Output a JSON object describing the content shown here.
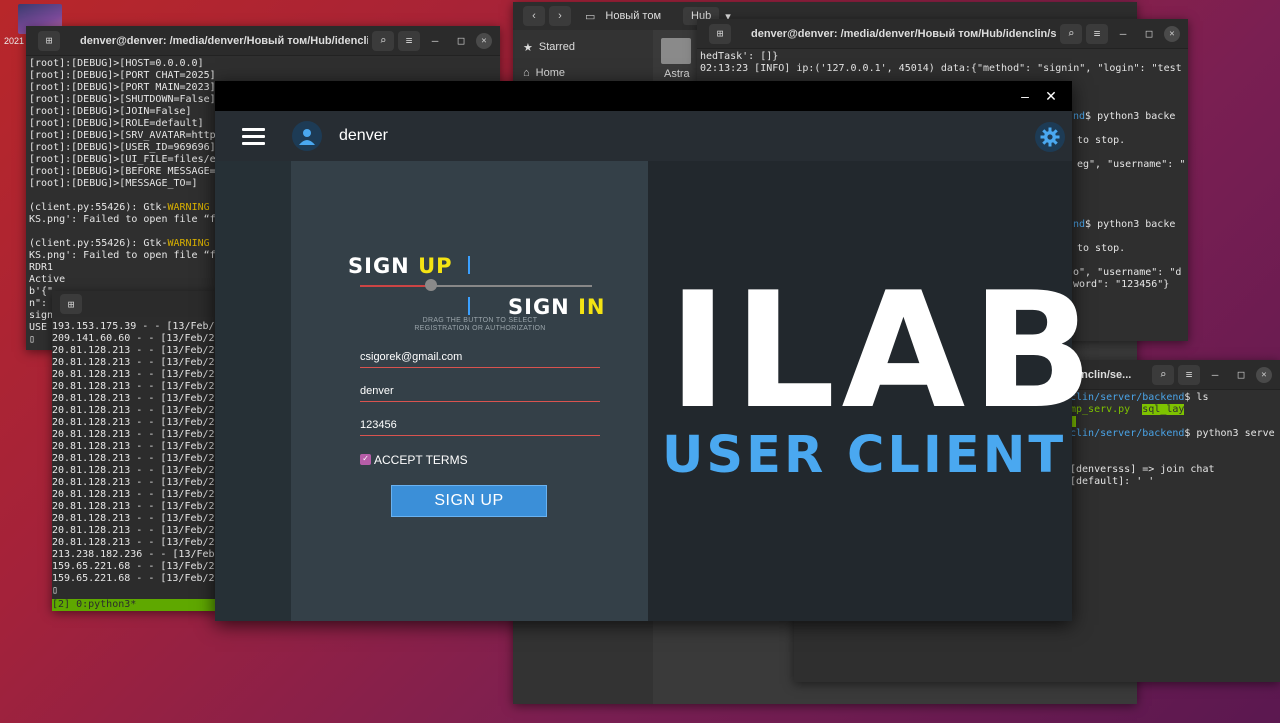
{
  "desktop": {
    "icon_label": "2021"
  },
  "file_manager": {
    "path": [
      "Новый том",
      "Hub"
    ],
    "sidebar": [
      "Starred",
      "Home"
    ],
    "folder_label": "Astra"
  },
  "term_left": {
    "title": "denver@denver: /media/denver/Новый том/Hub/idenclin/cli...",
    "lines": [
      "[root]:[DEBUG]>[HOST=0.0.0.0]",
      "[root]:[DEBUG]>[PORT CHAT=2025]",
      "[root]:[DEBUG]>[PORT MAIN=2023]",
      "[root]:[DEBUG]>[SHUTDOWN=False]",
      "[root]:[DEBUG]>[JOIN=False]",
      "[root]:[DEBUG]>[ROLE=default]",
      "[root]:[DEBUG]>[SRV_AVATAR=http",
      "[root]:[DEBUG]>[USER_ID=969696]",
      "[root]:[DEBUG]>[UI_FILE=files/e",
      "[root]:[DEBUG]>[BEFORE MESSAGE=",
      "[root]:[DEBUG]>[MESSAGE_TO=]",
      "",
      "(client.py:55426): Gtk-WARNING",
      "KS.png': Failed to open file “f",
      "",
      "(client.py:55426): Gtk-WARNING",
      "KS.png': Failed to open file “f",
      "RDR1",
      "Active",
      "b'{\"",
      "n\":",
      "sign",
      "USE",
      "▯"
    ]
  },
  "term_inner": {
    "lines": [
      "193.153.175.39 - - [13/Feb/",
      "209.141.60.60 - - [13/Feb/2",
      "20.81.128.213 - - [13/Feb/2",
      "20.81.128.213 - - [13/Feb/2",
      "20.81.128.213 - - [13/Feb/2",
      "20.81.128.213 - - [13/Feb/2",
      "20.81.128.213 - - [13/Feb/2",
      "20.81.128.213 - - [13/Feb/2",
      "20.81.128.213 - - [13/Feb/2",
      "20.81.128.213 - - [13/Feb/2",
      "20.81.128.213 - - [13/Feb/2",
      "20.81.128.213 - - [13/Feb/2",
      "20.81.128.213 - - [13/Feb/2",
      "20.81.128.213 - - [13/Feb/2",
      "20.81.128.213 - - [13/Feb/2",
      "20.81.128.213 - - [13/Feb/2",
      "20.81.128.213 - - [13/Feb/2",
      "20.81.128.213 - - [13/Feb/2",
      "20.81.128.213 - - [13/Feb/2",
      "213.238.182.236 - - [13/Feb",
      "159.65.221.68 - - [13/Feb/2",
      "159.65.221.68 - - [13/Feb/2",
      "▯"
    ],
    "status": "[2] 0:python3*"
  },
  "term_right_top": {
    "title": "denver@denver: /media/denver/Новый том/Hub/idenclin/se...",
    "line1": "hedTask': []}",
    "line2": "02:13:23 [INFO] ip:('127.0.0.1', 45014) data:{\"method\": \"signin\", \"login\": \"test",
    "line3a": "nd",
    "line3b": "$ python3 backe",
    "line4": "to stop.",
    "line5": "eg\", \"username\": \"",
    "line6a": "nd",
    "line6b": "$ python3 backe",
    "line7": "to stop.",
    "line8": "o\", \"username\": \"d",
    "line9": "word\": \"123456\"}"
  },
  "term_right_bottom": {
    "title": "lenclin/se...",
    "line1a": "clin/server/backend",
    "line1b": "$ ls",
    "line2a": "mp_serv.py",
    "line2b": "sql_lay",
    "line3a": "clin/server/backend",
    "line3b": "$ python3 serve",
    "line4": "[denversss] => join chat",
    "line5": "[default]: ' '"
  },
  "app": {
    "username": "denver",
    "signup_word": "SIGN ",
    "signup_accent": "UP",
    "signin_word": "SIGN ",
    "signin_accent": "IN",
    "hint_line1": "DRAG THE BUTTON TO SELECT",
    "hint_line2": "REGISTRATION OR AUTHORIZATION",
    "email_value": "csigorek@gmail.com",
    "login_value": "denver",
    "password_value": "123456",
    "accept_terms": "ACCEPT TERMS",
    "accept_checked": true,
    "signup_button": "SIGN UP",
    "brand_title": "ILAB",
    "brand_subtitle": "USER CLIENT",
    "slider_position": 0.3,
    "colors": {
      "accent_yellow": "#f4e313",
      "accent_blue": "#4aa8f0",
      "button_blue": "#3b8fd8"
    }
  }
}
